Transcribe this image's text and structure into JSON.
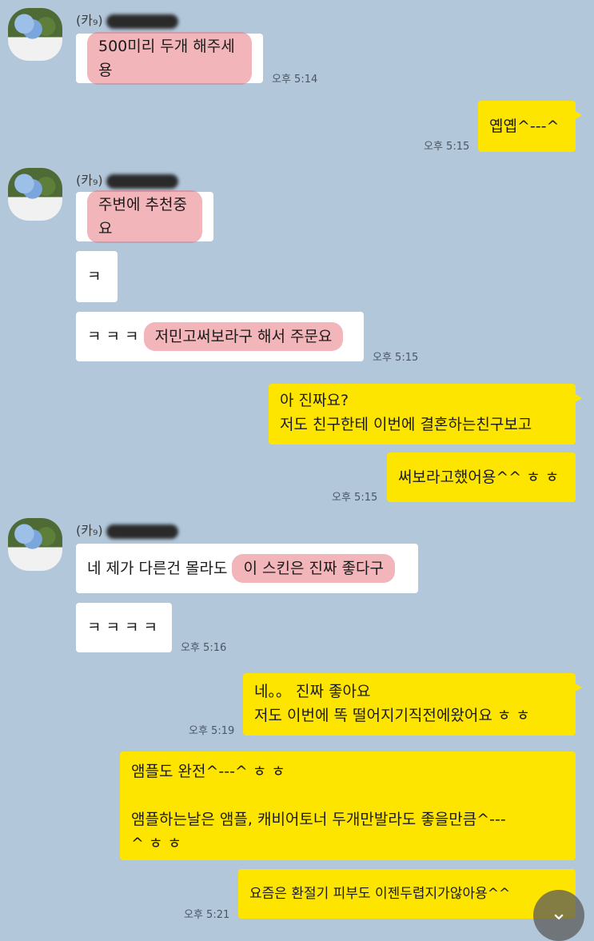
{
  "chat": {
    "sender_prefix": "(카₉)",
    "messages": {
      "m1": "500미리 두개 해주세용",
      "t1": "오후 5:14",
      "m2": "옙옙^---^",
      "t2": "오후 5:15",
      "m3": "주변에 추천중요",
      "m4": "ㅋ",
      "m5a": "ㅋ ㅋ ㅋ ",
      "m5b": "저민고써보라구 해서 주문요",
      "t3": "오후 5:15",
      "m6a": "아 진짜요?",
      "m6b": "저도 친구한테 이번에 결혼하는친구보고",
      "m7": "써보라고했어용^^ ㅎ ㅎ",
      "t4": "오후 5:15",
      "m8a": "네 제가 다른건 몰라도 ",
      "m8b": "이 스킨은 진짜 좋다구",
      "m9": "ㅋ ㅋ ㅋ ㅋ",
      "t5": "오후 5:16",
      "m10a": "네。。 진짜 좋아요",
      "m10b": "저도 이번에 똑 떨어지기직전에왔어요 ㅎ ㅎ",
      "t6": "오후 5:19",
      "m11a": "앰플도 완전^---^ ㅎ ㅎ",
      "m11b": "앰플하는날은 앰플, 캐비어토너 두개만발라도 좋을만큼^---",
      "m11c": "^ ㅎ ㅎ",
      "m12": "요즘은 환절기 피부도 이젠두렵지가않아용^^",
      "t7": "오후 5:21"
    }
  },
  "ui": {
    "scroll_down_icon": "chevron-down",
    "scroll_down_glyph": "⌄",
    "colors": {
      "background": "#b2c7da",
      "my_bubble": "#fee500",
      "their_bubble": "#ffffff"
    }
  }
}
